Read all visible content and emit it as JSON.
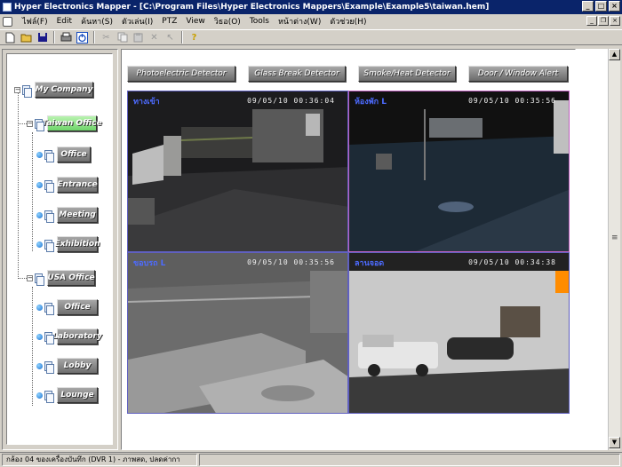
{
  "window": {
    "title": "Hyper Electronics Mapper - [C:\\Program Files\\Hyper Electronics Mappers\\Example\\Example5\\taiwan.hem]",
    "controls": {
      "minimize": "_",
      "maximize": "□",
      "close": "×"
    }
  },
  "menu": {
    "items": [
      "ไฟล์(F)",
      "Edit",
      "ค้นหา(S)",
      "ตัวเล่น(I)",
      "PTZ",
      "View",
      "วิธอ(O)",
      "Tools",
      "หน้าต่าง(W)",
      "ตัวช่วย(H)"
    ]
  },
  "toolbar": {
    "icons": [
      "new-icon",
      "open-icon",
      "save-icon",
      "print-icon",
      "power-icon",
      "cut-icon",
      "copy-icon",
      "paste-icon",
      "delete-icon",
      "pointer-icon",
      "help-icon"
    ]
  },
  "tree": {
    "root": {
      "label": "My Company"
    },
    "groups": [
      {
        "label": "Taiwan Office",
        "selected": true,
        "children": [
          "Office",
          "Entrance",
          "Meeting",
          "Exhibition"
        ]
      },
      {
        "label": "USA Office",
        "selected": false,
        "children": [
          "Office",
          "Laboratory",
          "Lobby",
          "Lounge"
        ]
      }
    ]
  },
  "alarms": {
    "buttons": [
      "Photoelectric Detector",
      "Glass Break Detector",
      "Smoke/Heat Detector",
      "Door / Window Alert"
    ]
  },
  "cameras": [
    {
      "label": "ทางเข้า",
      "timestamp": "09/05/10  00:36:04"
    },
    {
      "label": "ห้องพัก L",
      "timestamp": "09/05/10  00:35:56"
    },
    {
      "label": "ขอบรถ L",
      "timestamp": "09/05/10  00:35:56"
    },
    {
      "label": "ลานจอด",
      "timestamp": "09/05/10  00:34:38"
    }
  ],
  "status": {
    "message": "กล้อง 04 ของเครื่องบันทึก (DVR 1) - ภาพสด, ปลดค่ากา"
  }
}
